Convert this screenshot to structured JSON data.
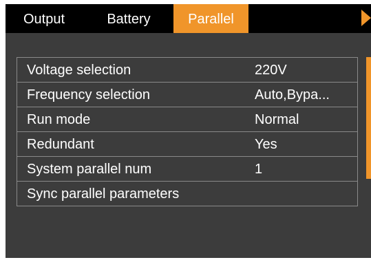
{
  "tabs": {
    "output": "Output",
    "battery": "Battery",
    "parallel": "Parallel",
    "next_icon": "triangle-right-icon"
  },
  "settings": [
    {
      "label": "Voltage selection",
      "value": "220V"
    },
    {
      "label": "Frequency selection",
      "value": "Auto,Bypa..."
    },
    {
      "label": "Run mode",
      "value": "Normal"
    },
    {
      "label": "Redundant",
      "value": "Yes"
    },
    {
      "label": "System parallel num",
      "value": "1"
    },
    {
      "label": "Sync parallel parameters",
      "value": ""
    }
  ],
  "colors": {
    "accent": "#f0952a",
    "background": "#3c3c3c",
    "tabbar": "#000000",
    "text": "#ffffff",
    "row_border": "#8a8a8a"
  }
}
